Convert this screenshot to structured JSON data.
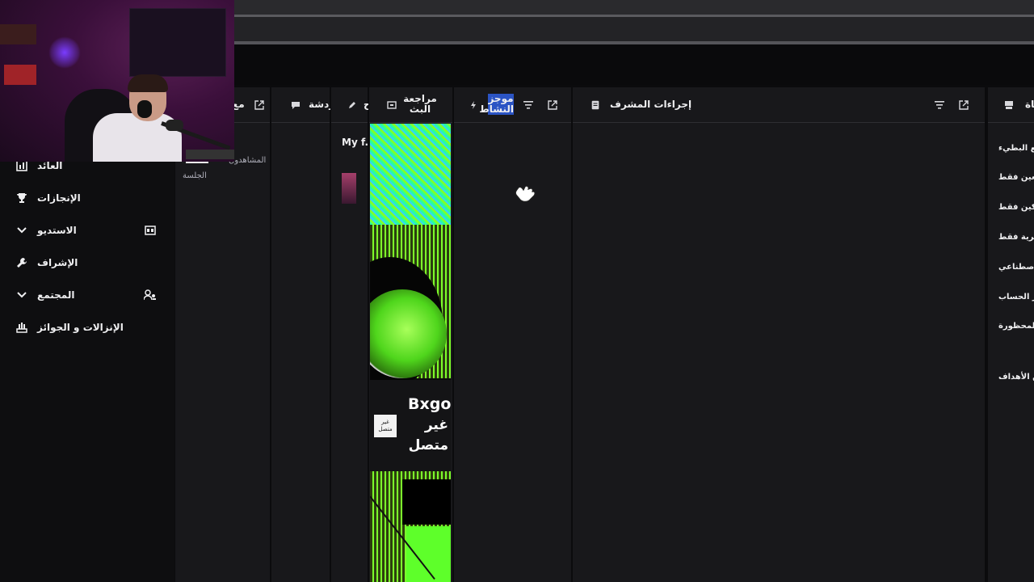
{
  "nav": {
    "items": [
      {
        "label": "العائد",
        "icon": "revenue-icon"
      },
      {
        "label": "الإنجازات",
        "icon": "trophy-icon"
      },
      {
        "label": "الاستديو",
        "icon": "chevron-down-icon",
        "right_icon": "studio-icon"
      },
      {
        "label": "الإشراف",
        "icon": "wrench-icon"
      },
      {
        "label": "المجتمع",
        "icon": "chevron-down-icon",
        "right_icon": "community-icon"
      },
      {
        "label": "الإنزالات و الجوائز",
        "icon": "drops-icon"
      }
    ]
  },
  "panels": {
    "p1_title": "مع",
    "viewers": "المشاهدون",
    "session": "الجلسة",
    "chat_title": "دردشة",
    "p3_title": "ح",
    "stream_review_title": "مراجعة البث",
    "activity_title": "موجز النشاط",
    "mod_actions_title": "إجراءات المشرف",
    "right_title": "قناة"
  },
  "mini": {
    "text": "My f..."
  },
  "video": {
    "channel_name": "Bxgo",
    "status": "غير متصل",
    "badge": "غير متصل"
  },
  "right_panel": {
    "items": [
      "وضع البطيء",
      "المتابعين فقط",
      "المشتركين فقط",
      "الرموز التعبيرية فقط",
      "الذكاء الاصطناعي",
      "عمر الحساب",
      "الكلمات المحظورة",
      "تعيين الأهداف"
    ]
  },
  "colors": {
    "panel_bg": "#18181b",
    "selection": "#2b54c4",
    "preview_green": "#7dff2e"
  }
}
